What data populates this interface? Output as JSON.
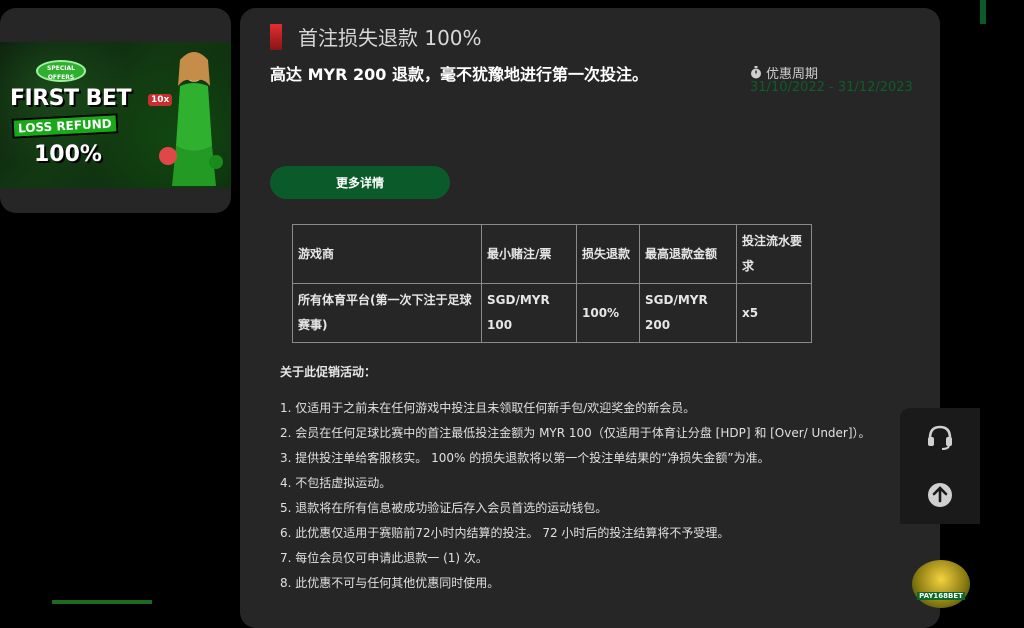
{
  "banner": {
    "special_offers": "SPECIAL OFFERS",
    "headline": "FIRST BET",
    "subline": "LOSS REFUND",
    "percent": "100%",
    "multiplier": "10x"
  },
  "promo": {
    "title": "首注损失退款 100%",
    "subtitle": "高达 MYR 200 退款，毫不犹豫地进行第一次投注。",
    "period_label": "优惠周期",
    "period_value": "31/10/2022 - 31/12/2023",
    "details_button": "更多详情",
    "accent_color": "#0b5a2a",
    "title_bar_color": "#c62828"
  },
  "table": {
    "headers": [
      "游戏商",
      "最小赌注/票",
      "损失退款",
      "最高退款金额",
      "投注流水要求"
    ],
    "rows": [
      [
        "所有体育平台(第一次下注于足球赛事)",
        "SGD/MYR 100",
        "100%",
        "SGD/MYR 200",
        "x5"
      ]
    ]
  },
  "about_heading": "关于此促销活动：",
  "rules": [
    "1. 仅适用于之前未在任何游戏中投注且未领取任何新手包/欢迎奖金的新会员。",
    "2. 会员在任何足球比赛中的首注最低投注金额为 MYR 100（仅适用于体育让分盘 [HDP] 和 [Over/ Under]）。",
    "3. 提供投注单给客服核实。 100% 的损失退款将以第一个投注单结果的“净损失金额”为准。",
    "4. 不包括虚拟运动。",
    "5. 退款将在所有信息被成功验证后存入会员首选的运动钱包。",
    "6. 此优惠仅适用于赛赔前72小时内结算的投注。 72 小时后的投注结算将不予受理。",
    "7. 每位会员仅可申请此退款一 (1) 次。",
    "8. 此优惠不可与任何其他优惠同时使用。"
  ],
  "widgets": {
    "support_icon": "headset-icon",
    "top_icon": "arrow-up-icon",
    "mascot_label": "PAY168BET"
  }
}
